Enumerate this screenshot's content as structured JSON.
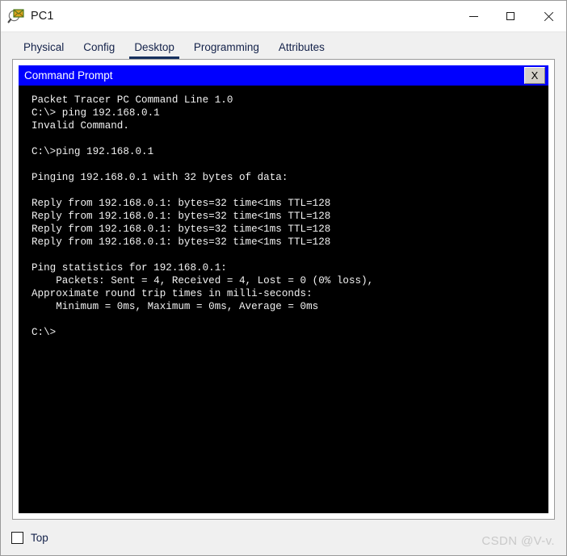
{
  "window": {
    "title": "PC1",
    "icon": "packet-tracer-inspect-icon",
    "controls": {
      "minimize": "—",
      "maximize": "□",
      "close": "×"
    }
  },
  "tabs": [
    {
      "label": "Physical",
      "active": false
    },
    {
      "label": "Config",
      "active": false
    },
    {
      "label": "Desktop",
      "active": true
    },
    {
      "label": "Programming",
      "active": false
    },
    {
      "label": "Attributes",
      "active": false
    }
  ],
  "command_prompt": {
    "title": "Command Prompt",
    "close_label": "X",
    "title_bar_color": "#0000ff",
    "terminal_bg": "#000000",
    "terminal_fg": "#f2f2f2",
    "output": "Packet Tracer PC Command Line 1.0\nC:\\> ping 192.168.0.1\nInvalid Command.\n\nC:\\>ping 192.168.0.1\n\nPinging 192.168.0.1 with 32 bytes of data:\n\nReply from 192.168.0.1: bytes=32 time<1ms TTL=128\nReply from 192.168.0.1: bytes=32 time<1ms TTL=128\nReply from 192.168.0.1: bytes=32 time<1ms TTL=128\nReply from 192.168.0.1: bytes=32 time<1ms TTL=128\n\nPing statistics for 192.168.0.1:\n    Packets: Sent = 4, Received = 4, Lost = 0 (0% loss),\nApproximate round trip times in milli-seconds:\n    Minimum = 0ms, Maximum = 0ms, Average = 0ms\n\nC:\\>"
  },
  "footer": {
    "top_checkbox_label": "Top",
    "top_checkbox_checked": false,
    "watermark": "CSDN @V-v."
  }
}
